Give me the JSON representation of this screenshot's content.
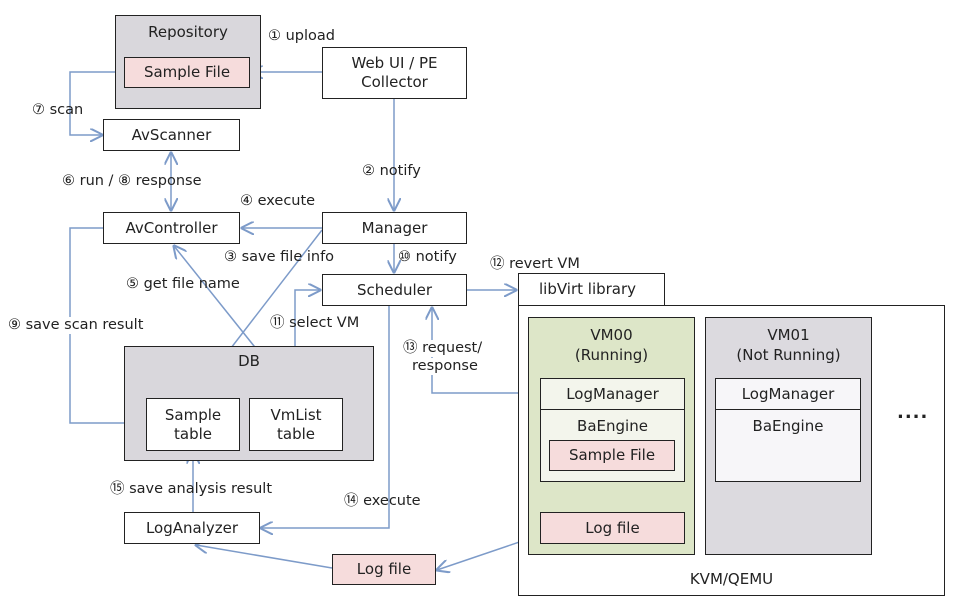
{
  "colors": {
    "arrow": "#7d9bc9",
    "group_gray": "#d9d7dc",
    "vm_running": "#dde6c8",
    "vm_stopped": "#dcdadf",
    "doc_pink": "#f6dcdc"
  },
  "nodes": {
    "repository": "Repository",
    "repo_sample_file": "Sample File",
    "web_ui": "Web UI / PE Collector",
    "av_scanner": "AvScanner",
    "av_controller": "AvController",
    "manager": "Manager",
    "scheduler": "Scheduler",
    "libvirt": "libVirt library",
    "kvm": "KVM/QEMU",
    "db": "DB",
    "sample_table": "Sample table",
    "vmlist_table": "VmList table",
    "log_analyzer": "LogAnalyzer",
    "log_file_out": "Log file",
    "vm00": {
      "name": "VM00",
      "status": "(Running)",
      "log_manager": "LogManager",
      "ba_engine": "BaEngine",
      "sample_file": "Sample File",
      "log_file": "Log file"
    },
    "vm01": {
      "name": "VM01",
      "status": "(Not Running)",
      "log_manager": "LogManager",
      "ba_engine": "BaEngine"
    },
    "more": "...."
  },
  "edges": {
    "e1": "① upload",
    "e2": "② notify",
    "e3": "③ save file info",
    "e4": "④ execute",
    "e5": "⑤ get file name",
    "e6_8": "⑥ run / ⑧ response",
    "e7": "⑦ scan",
    "e9": "⑨ save scan result",
    "e10": "⑩ notify",
    "e11": "⑪ select VM",
    "e12": "⑫ revert VM",
    "e13a": "⑬ request/",
    "e13b": "response",
    "e14": "⑭ execute",
    "e15": "⑮ save analysis result"
  }
}
